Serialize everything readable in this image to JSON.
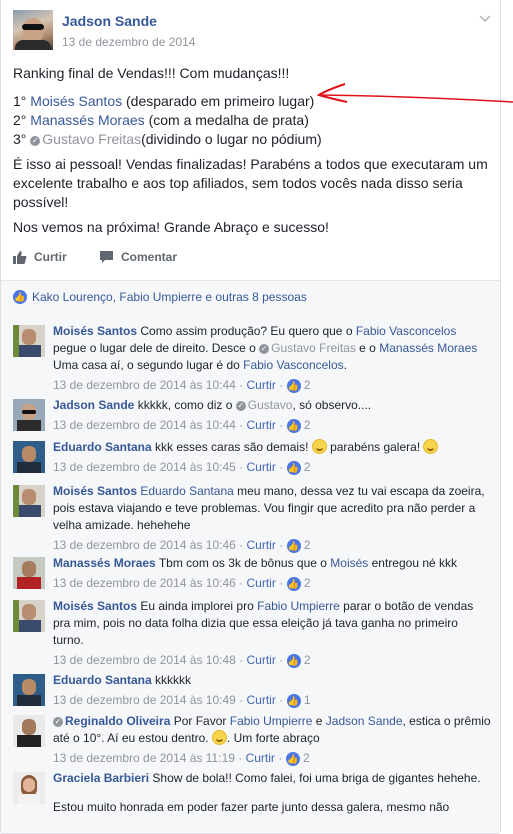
{
  "post": {
    "author": "Jadson Sande",
    "date": "13 de dezembro de 2014",
    "title_line": "Ranking final de Vendas!!! Com mudanças!!!",
    "ranking": [
      {
        "pos": "1°",
        "name": "Moisés Santos",
        "note": "(desparado em primeiro lugar)"
      },
      {
        "pos": "2°",
        "name": "Manassés Moraes",
        "note": "(com a medalha de prata)"
      },
      {
        "pos": "3°",
        "name": "Gustavo Freitas",
        "note": "(dividindo o lugar no pódium)"
      }
    ],
    "paragraph_1": "É isso ai pessoal! Vendas finalizadas! Parabéns a todos que executaram um excelente trabalho e aos top afiliados, sem todos vocês nada disso seria possível!",
    "paragraph_2": "Nos vemos na próxima! Grande Abraço e sucesso!",
    "actions": {
      "like": "Curtir",
      "comment": "Comentar"
    },
    "reactions": "Kako Lourenço, Fabio Umpierre e outras 8 pessoas"
  },
  "comments": [
    {
      "name": "Moisés Santos",
      "date": "13 de dezembro de 2014 às 10:44",
      "like": "Curtir",
      "count": "2"
    },
    {
      "name": "Jadson Sande",
      "date": "13 de dezembro de 2014 às 10:44",
      "like": "Curtir",
      "count": "2"
    },
    {
      "name": "Eduardo Santana",
      "date": "13 de dezembro de 2014 às 10:45",
      "like": "Curtir",
      "count": "2"
    },
    {
      "name": "Moisés Santos",
      "date": "13 de dezembro de 2014 às 10:46",
      "like": "Curtir",
      "count": "2"
    },
    {
      "name": "Manassés Moraes",
      "date": "13 de dezembro de 2014 às 10:46",
      "like": "Curtir",
      "count": "2"
    },
    {
      "name": "Moisés Santos",
      "date": "13 de dezembro de 2014 às 10:48",
      "like": "Curtir",
      "count": "2"
    },
    {
      "name": "Eduardo Santana",
      "date": "13 de dezembro de 2014 às 10:49",
      "like": "Curtir",
      "count": "1"
    },
    {
      "name": "Reginaldo Oliveira",
      "date": "13 de dezembro de 2014 às 11:19",
      "like": "Curtir",
      "count": "2"
    },
    {
      "name": "Graciela Barbieri",
      "date": "",
      "like": "",
      "count": ""
    }
  ],
  "c1": {
    "t1": " Como assim produção? Eu quero que o ",
    "m1": "Fabio Vasconcelos",
    "t2": " pegue o lugar dele de direito. Desce o ",
    "m2": "Gustavo Freitas",
    "t3": " e o ",
    "m3": "Manassés Moraes",
    "t4": " Uma casa aí, o segundo lugar é do ",
    "m4": "Fabio Vasconcelos",
    "t5": "."
  },
  "c2": {
    "t1": " kkkkk, como diz o ",
    "m1": "Gustavo",
    "t2": ", só observo...."
  },
  "c3": {
    "t1": " kkk esses caras são demais! ",
    "t2": " parabéns galera! "
  },
  "c4": {
    "m1": "Eduardo Santana",
    "t1": " meu mano, dessa vez tu vai escapa da zoeira, pois estava viajando e teve problemas. Vou fingir que acredito pra não perder a velha amizade. hehehehe"
  },
  "c5": {
    "t1": " Tbm com os 3k de bônus que o ",
    "m1": "Moisés",
    "t2": " entregou né kkk"
  },
  "c6": {
    "t1": " Eu ainda implorei pro ",
    "m1": "Fabio Umpierre",
    "t2": " parar o botão de vendas pra mim, pois no data folha dizia que essa eleição já tava ganha no primeiro turno."
  },
  "c7": {
    "t1": " kkkkkk"
  },
  "c8": {
    "t1": " Por Favor ",
    "m1": "Fabio Umpierre",
    "t2": " e ",
    "m2": "Jadson Sande",
    "t3": ", estica o prêmio até o 10°. Aí eu estou dentro. ",
    "t4": ". Um forte abraço"
  },
  "c9": {
    "t1": " Show de bola!! Como falei, foi uma briga de gigantes hehehe.",
    "t2": "Estou muito honrada em poder fazer parte junto dessa galera, mesmo não"
  }
}
